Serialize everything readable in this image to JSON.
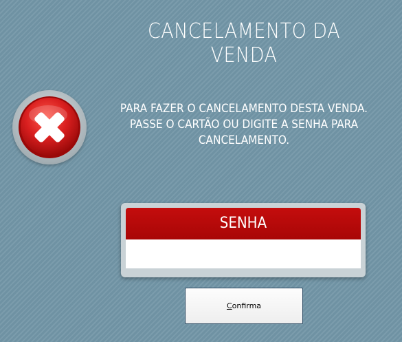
{
  "dialog": {
    "title": "CANCELAMENTO DA VENDA",
    "message_lines": [
      "PARA FAZER O CANCELAMENTO DESTA VENDA.",
      "PASSE O CARTÃO OU DIGITE A SENHA PARA",
      "CANCELAMENTO."
    ],
    "icon": "error-x-icon"
  },
  "senha": {
    "label": "SENHA",
    "value": ""
  },
  "confirm_button": {
    "mnemonic": "C",
    "label_rest": "onfirma"
  },
  "colors": {
    "header_red": "#c40d0d",
    "icon_red": "#d91f1f",
    "background": "#6f92a3"
  }
}
